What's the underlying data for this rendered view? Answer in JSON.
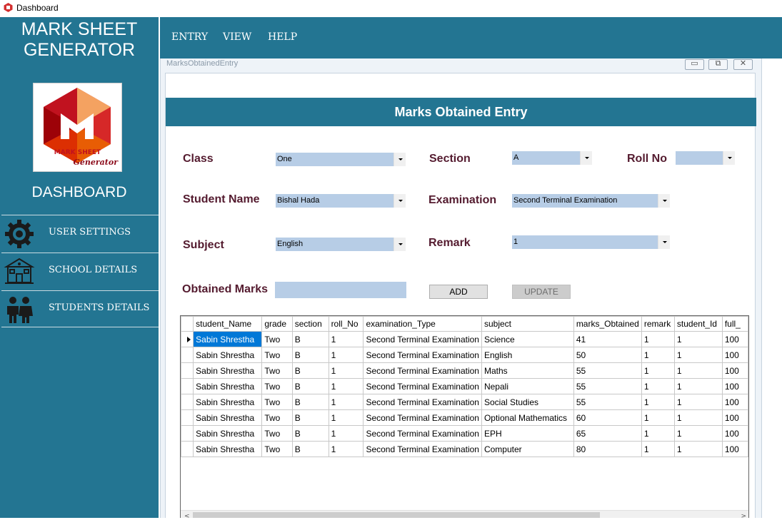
{
  "window": {
    "title": "Dashboard"
  },
  "sidebar": {
    "brand_line1": "MARK SHEET",
    "brand_line2": "GENERATOR",
    "logo_text_line1": "MARK SHEET",
    "logo_text_line2": "Generator",
    "dashboard_label": "DASHBOARD",
    "items": [
      {
        "label": "USER SETTINGS",
        "icon": "gear-icon"
      },
      {
        "label": "SCHOOL DETAILS",
        "icon": "school-icon"
      },
      {
        "label": "STUDENTS DETAILS",
        "icon": "students-icon"
      }
    ]
  },
  "menu": {
    "items": [
      "ENTRY",
      "VIEW",
      "HELP"
    ]
  },
  "child_window": {
    "title": "MarksObtainedEntry",
    "buttons": {
      "minimize": "▭",
      "restore": "⧉",
      "close": "✕"
    }
  },
  "form": {
    "header": "Marks Obtained Entry",
    "labels": {
      "class": "Class",
      "section": "Section",
      "roll_no": "Roll No",
      "student_name": "Student Name",
      "examination": "Examination",
      "subject": "Subject",
      "remark": "Remark",
      "obtained_marks": "Obtained Marks"
    },
    "values": {
      "class": "One",
      "section": "A",
      "roll_no": "",
      "student_name": "Bishal Hada",
      "examination": "Second Terminal Examination",
      "subject": "English",
      "remark": "1",
      "obtained_marks": ""
    },
    "buttons": {
      "add": "ADD",
      "update": "UPDATE"
    }
  },
  "grid": {
    "columns": [
      "student_Name",
      "grade",
      "section",
      "roll_No",
      "examination_Type",
      "subject",
      "marks_Obtained",
      "remark",
      "student_Id",
      "full_"
    ],
    "rows": [
      [
        "Sabin Shrestha",
        "Two",
        "B",
        "1",
        "Second Terminal Examination",
        "Science",
        "41",
        "1",
        "1",
        "100"
      ],
      [
        "Sabin Shrestha",
        "Two",
        "B",
        "1",
        "Second Terminal Examination",
        "English",
        "50",
        "1",
        "1",
        "100"
      ],
      [
        "Sabin Shrestha",
        "Two",
        "B",
        "1",
        "Second Terminal Examination",
        "Maths",
        "55",
        "1",
        "1",
        "100"
      ],
      [
        "Sabin Shrestha",
        "Two",
        "B",
        "1",
        "Second Terminal Examination",
        "Nepali",
        "55",
        "1",
        "1",
        "100"
      ],
      [
        "Sabin Shrestha",
        "Two",
        "B",
        "1",
        "Second Terminal Examination",
        "Social Studies",
        "55",
        "1",
        "1",
        "100"
      ],
      [
        "Sabin Shrestha",
        "Two",
        "B",
        "1",
        "Second Terminal Examination",
        "Optional Mathematics",
        "60",
        "1",
        "1",
        "100"
      ],
      [
        "Sabin Shrestha",
        "Two",
        "B",
        "1",
        "Second Terminal Examination",
        "EPH",
        "65",
        "1",
        "1",
        "100"
      ],
      [
        "Sabin Shrestha",
        "Two",
        "B",
        "1",
        "Second Terminal Examination",
        "Computer",
        "80",
        "1",
        "1",
        "100"
      ]
    ],
    "scroll_left": "<",
    "scroll_right": ">"
  },
  "colors": {
    "brand": "#237592",
    "label": "#541b2f",
    "field": "#b7cde6",
    "selection": "#0078d7"
  }
}
